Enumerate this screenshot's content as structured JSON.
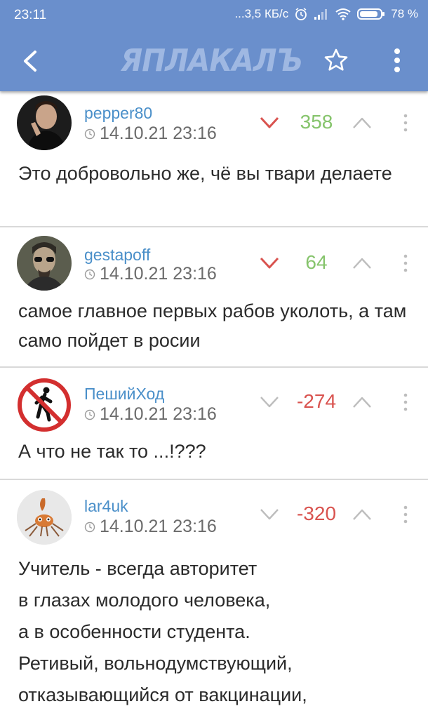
{
  "status_bar": {
    "time": "23:11",
    "network_speed": "...3,5 КБ/с",
    "battery": "78 %"
  },
  "app_bar": {
    "logo_text": "ЯПЛАКАЛЪ",
    "icons": [
      "back-arrow-icon",
      "star-icon",
      "more-vert-icon"
    ]
  },
  "colors": {
    "app_bar": "#6a8fcc",
    "username": "#4a8fc9",
    "score_positive": "#86c46c",
    "score_negative": "#d9534f"
  },
  "comments": [
    {
      "username": "pepper80",
      "timestamp": "14.10.21 23:16",
      "score": "358",
      "score_sign": "positive",
      "text": "Это добровольно же, чё вы твари делаете"
    },
    {
      "username": "gestapoff",
      "timestamp": "14.10.21 23:16",
      "score": "64",
      "score_sign": "positive",
      "text": "самое главное первых рабов уколоть, а там само пойдет в росии"
    },
    {
      "username": "ПешийХод",
      "timestamp": "14.10.21 23:16",
      "score": "-274",
      "score_sign": "negative",
      "text": "А что не так то ...!???"
    },
    {
      "username": "lar4uk",
      "timestamp": "14.10.21 23:16",
      "score": "-320",
      "score_sign": "negative",
      "text_lines": [
        "Учитель - всегда авторитет",
        "в глазах молодого человека,",
        "а в особенности студента.",
        "Ретивый, вольнодумствующий,",
        "отказывающийся от вакцинации,"
      ]
    }
  ]
}
